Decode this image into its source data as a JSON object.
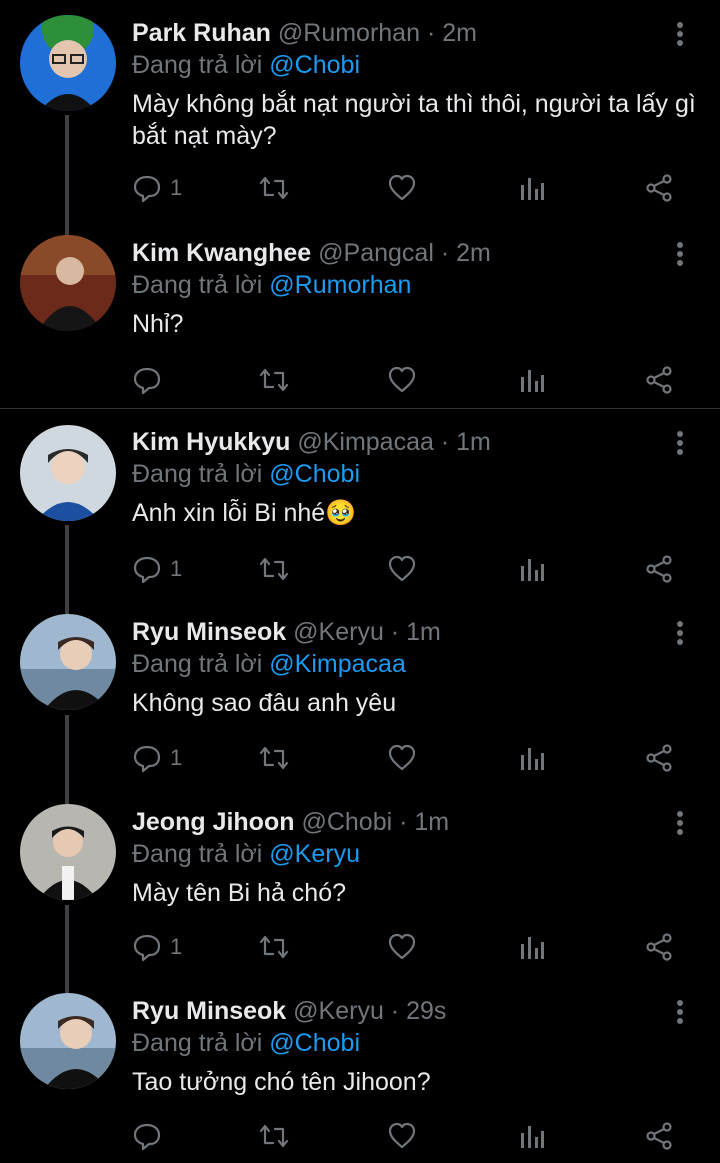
{
  "reply_prefix": "Đang trả lời",
  "tweets": [
    {
      "name": "Park Ruhan",
      "handle": "@Rumorhan",
      "dot": "·",
      "time": "2m",
      "mention": "@Chobi",
      "text": "Mày không bắt nạt người ta thì thôi, người ta lấy gì bắt nạt mày?",
      "reply_count": "1"
    },
    {
      "name": "Kim Kwanghee",
      "handle": "@Pangcal",
      "dot": "·",
      "time": "2m",
      "mention": "@Rumorhan",
      "text": "Nhỉ?",
      "reply_count": ""
    },
    {
      "name": "Kim Hyukkyu",
      "handle": "@Kimpacaa",
      "dot": "·",
      "time": "1m",
      "mention": "@Chobi",
      "text": "Anh xin lỗi Bi nhé🥹",
      "reply_count": "1"
    },
    {
      "name": "Ryu Minseok",
      "handle": "@Keryu",
      "dot": "·",
      "time": "1m",
      "mention": "@Kimpacaa",
      "text": "Không sao đâu anh yêu",
      "reply_count": "1"
    },
    {
      "name": "Jeong Jihoon",
      "handle": "@Chobi",
      "dot": "·",
      "time": "1m",
      "mention": "@Keryu",
      "text": "Mày tên Bi hả chó?",
      "reply_count": "1"
    },
    {
      "name": "Ryu Minseok",
      "handle": "@Keryu",
      "dot": "·",
      "time": "29s",
      "mention": "@Chobi",
      "text": "Tao tưởng chó tên Jihoon?",
      "reply_count": ""
    }
  ],
  "colors": {
    "background": "#000000",
    "text": "#e7e9ea",
    "secondary": "#71767b",
    "accent": "#1d9bf0",
    "divider": "#2f3336"
  },
  "icons": [
    "reply-icon",
    "retweet-icon",
    "like-icon",
    "analytics-icon",
    "share-icon",
    "more-icon"
  ]
}
